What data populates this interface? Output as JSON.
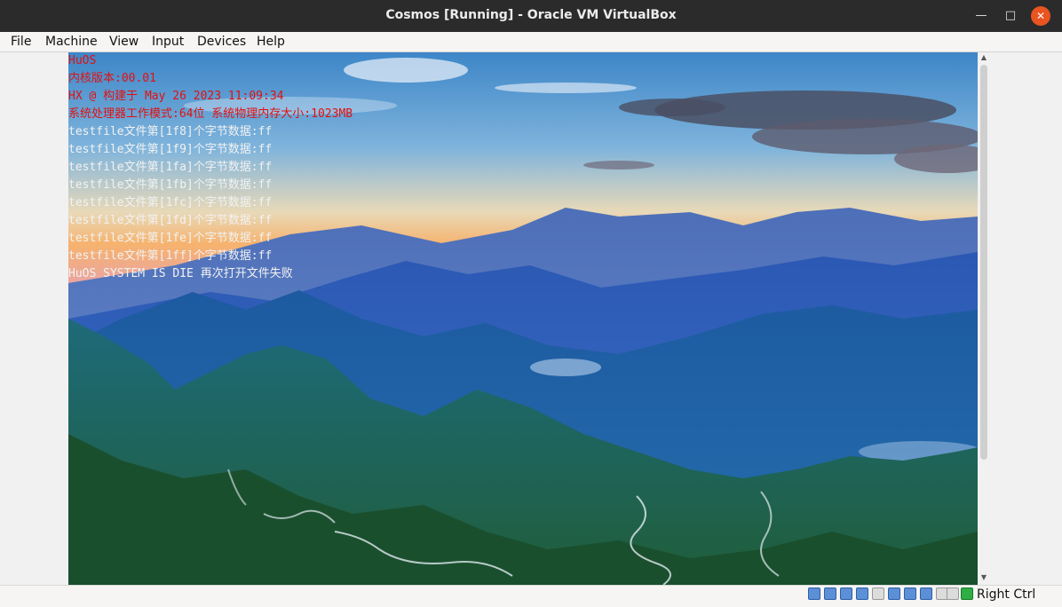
{
  "window": {
    "title": "Cosmos [Running] - Oracle VM VirtualBox",
    "minimize_icon": "minimize-icon",
    "maximize_icon": "maximize-icon",
    "close_icon": "close-icon"
  },
  "menubar": {
    "items": [
      "File",
      "Machine",
      "View",
      "Input",
      "Devices",
      "Help"
    ]
  },
  "console": {
    "lines": [
      {
        "text": "HuOS",
        "color": "#e21010"
      },
      {
        "text": "内核版本:00.01",
        "color": "#e21010"
      },
      {
        "text": "HX @ 构建于 May 26 2023 11:09:34",
        "color": "#e21010"
      },
      {
        "text": "系统处理器工作模式:64位 系统物理内存大小:1023MB",
        "color": "#e21010"
      },
      {
        "text": "testfile文件第[1f8]个字节数据:ff",
        "color": "#f2f2f2"
      },
      {
        "text": "testfile文件第[1f9]个字节数据:ff",
        "color": "#f2f2f2"
      },
      {
        "text": "testfile文件第[1fa]个字节数据:ff",
        "color": "#f2f2f2"
      },
      {
        "text": "testfile文件第[1fb]个字节数据:ff",
        "color": "#f2f2f2"
      },
      {
        "text": "testfile文件第[1fc]个字节数据:ff",
        "color": "#f2f2f2"
      },
      {
        "text": "testfile文件第[1fd]个字节数据:ff",
        "color": "#f2f2f2"
      },
      {
        "text": "testfile文件第[1fe]个字节数据:ff",
        "color": "#f2f2f2"
      },
      {
        "text": "testfile文件第[1ff]个字节数据:ff",
        "color": "#f2f2f2"
      },
      {
        "text": "HuOS SYSTEM IS DIE 再次打开文件失败",
        "color": "#f2f2f2"
      }
    ]
  },
  "statusbar": {
    "icons": [
      "hard-disk-icon",
      "optical-drive-icon",
      "audio-icon",
      "network-icon",
      "usb-icon",
      "shared-folders-icon",
      "display-icon",
      "video-capture-icon",
      "cpu-icon",
      "mouse-integration-icon",
      "keyboard-icon"
    ],
    "host_key": "Right Ctrl"
  },
  "colors": {
    "titlebar_bg": "#2b2b2b",
    "close_button": "#e95420",
    "console_red": "#e21010",
    "console_white": "#f2f2f2"
  }
}
